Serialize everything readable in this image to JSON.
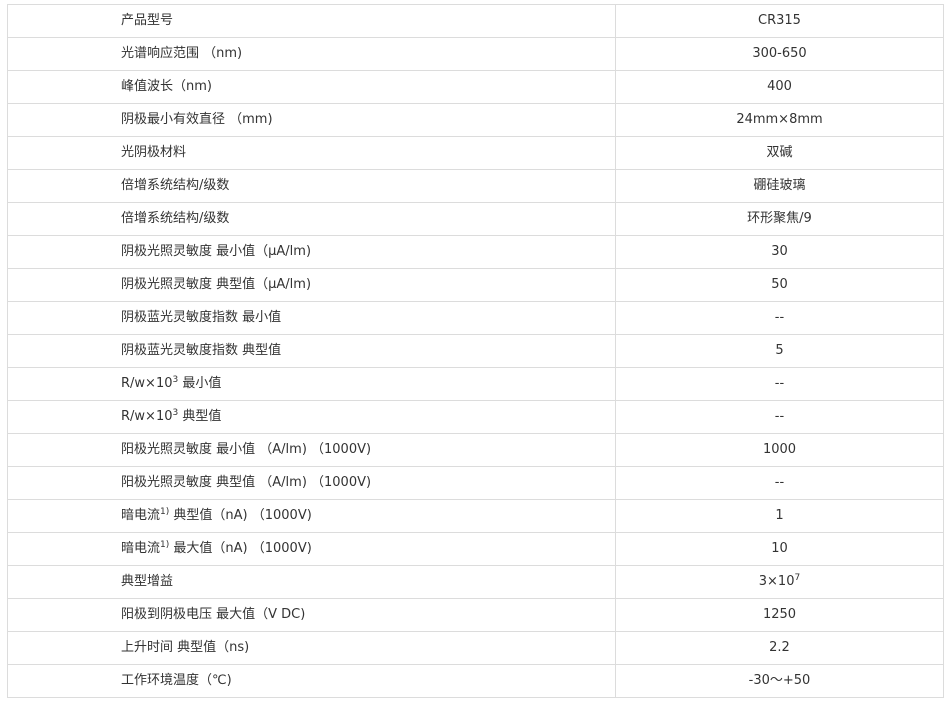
{
  "table": {
    "rows": [
      {
        "label": "产品型号",
        "value": "CR315"
      },
      {
        "label": "光谱响应范围 （nm)",
        "value": "300-650"
      },
      {
        "label": "峰值波长（nm)",
        "value": "400"
      },
      {
        "label": "阴极最小有效直径 （mm)",
        "value": "24mm×8mm"
      },
      {
        "label": "光阴极材料",
        "value": "双碱"
      },
      {
        "label": "倍增系统结构/级数",
        "value": "硼硅玻璃"
      },
      {
        "label": "倍增系统结构/级数",
        "value": "环形聚焦/9"
      },
      {
        "label": "阴极光照灵敏度 最小值（μA/lm)",
        "value": "30"
      },
      {
        "label": "阴极光照灵敏度 典型值（μA/lm)",
        "value": "50"
      },
      {
        "label": "阴极蓝光灵敏度指数 最小值",
        "value": "--"
      },
      {
        "label": "阴极蓝光灵敏度指数 典型值",
        "value": "5"
      },
      {
        "label_pre": "R/w×10",
        "label_sup": "3",
        "label_post": " 最小值",
        "value": "--"
      },
      {
        "label_pre": "R/w×10",
        "label_sup": "3",
        "label_post": " 典型值",
        "value": "--"
      },
      {
        "label": "阳极光照灵敏度 最小值 （A/lm) （1000V)",
        "value": "1000"
      },
      {
        "label": "阳极光照灵敏度 典型值 （A/lm) （1000V)",
        "value": "--"
      },
      {
        "label_pre": "暗电流",
        "label_sup": "1)",
        "label_post": " 典型值（nA) （1000V)",
        "value": "1"
      },
      {
        "label_pre": "暗电流",
        "label_sup": "1)",
        "label_post": " 最大值（nA) （1000V)",
        "value": "10"
      },
      {
        "label": "典型增益",
        "value_pre": "3×10",
        "value_sup": "7"
      },
      {
        "label": "阳极到阴极电压 最大值（V DC)",
        "value": "1250"
      },
      {
        "label": "上升时间 典型值（ns)",
        "value": "2.2"
      },
      {
        "label": "工作环境温度（℃)",
        "value": "-30～+50"
      }
    ]
  }
}
